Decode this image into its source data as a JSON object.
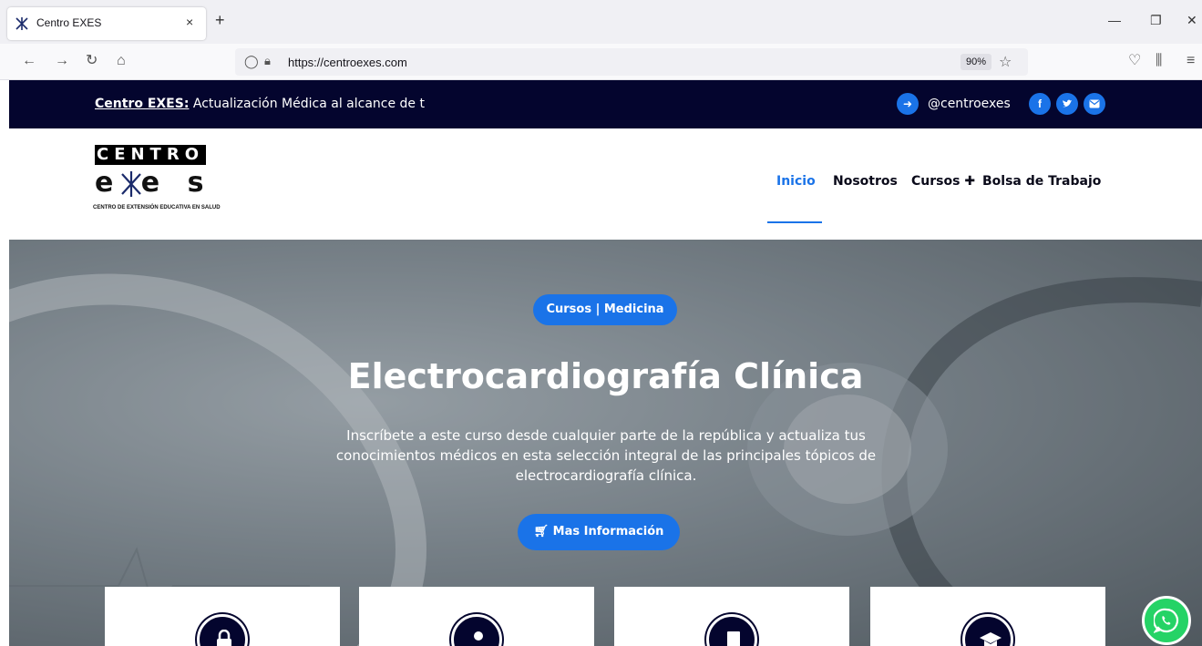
{
  "browser": {
    "tab_title": "Centro EXES",
    "close_tab": "×",
    "new_tab": "+",
    "url": "https://centroexes.com",
    "zoom": "90%"
  },
  "topbar": {
    "brand": "Centro EXES:",
    "tagline": " Actualización Médica al alcance de t",
    "handle": "@centroexes",
    "social": [
      "f",
      "t",
      "m"
    ]
  },
  "logo": {
    "top": "CENTRO",
    "mark": "e e s",
    "subtitle": "CENTRO DE EXTENSIÓN EDUCATIVA EN SALUD"
  },
  "menu": {
    "inicio": "Inicio",
    "nosotros": "Nosotros",
    "cursos": "Cursos",
    "cursos_plus": "✚",
    "bolsa": "Bolsa de Trabajo"
  },
  "hero": {
    "badge": "Cursos | Medicina",
    "title": "Electrocardiografía Clínica",
    "description": "Inscríbete a este curso desde cualquier parte de la república y actualiza tus conocimientos médicos en esta selección integral de las principales tópicos de electrocardiografía clínica.",
    "button": "Mas Información"
  },
  "cards": [
    {
      "icon": "lock-icon"
    },
    {
      "icon": "doctor-icon"
    },
    {
      "icon": "book-icon"
    },
    {
      "icon": "graduation-cap-icon"
    }
  ],
  "colors": {
    "primary": "#1a73e8",
    "dark": "#04052e",
    "whatsapp": "#25d366"
  }
}
